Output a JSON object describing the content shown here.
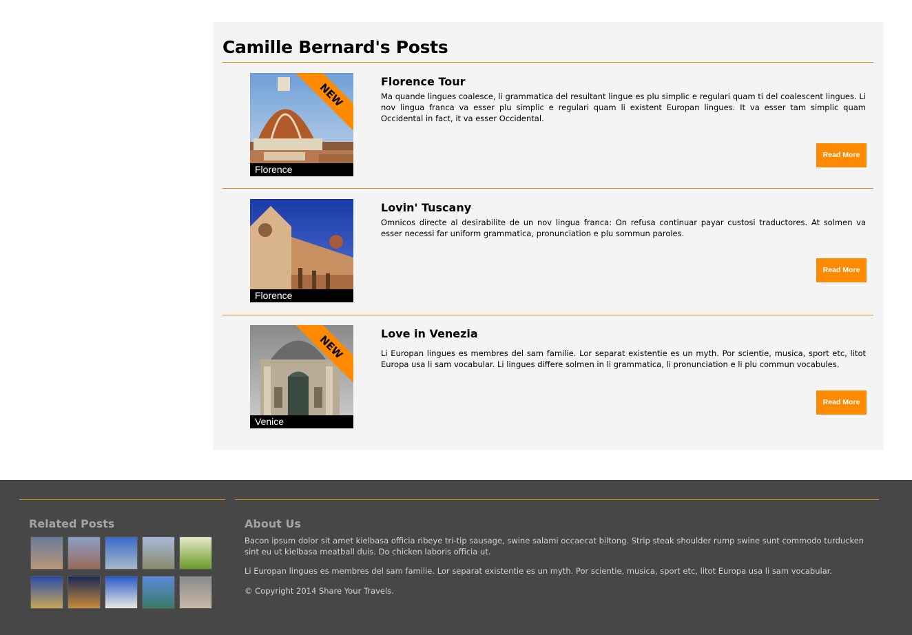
{
  "page": {
    "title": "Camille Bernard's Posts"
  },
  "posts": [
    {
      "title": "Florence Tour",
      "caption": "Florence",
      "badge": "NEW",
      "body": "Ma quande lingues coalesce, li grammatica del resultant lingue es plu simplic e regulari quam ti del coalescent lingues. Li nov lingua franca va esser plu simplic e regulari quam li existent Europan lingues. It va esser tam simplic quam Occidental in fact, it va esser Occidental.",
      "button": "Read More"
    },
    {
      "title": "Lovin' Tuscany",
      "caption": "Florence",
      "badge": "",
      "body": "Omnicos directe al desirabilite de un nov lingua franca: On refusa continuar payar custosi traductores. At solmen va esser necessi far uniform grammatica, pronunciation e plu sommun paroles.",
      "button": "Read More"
    },
    {
      "title": "Love in Venezia",
      "caption": "Venice",
      "badge": "NEW",
      "body": "Li Europan lingues es membres del sam familie. Lor separat existentie es un myth. Por scientie, musica, sport etc, litot Europa usa li sam vocabular. Li lingues differe solmen in li grammatica, li pronunciation e li plu commun vocabules.",
      "button": "Read More"
    }
  ],
  "footer": {
    "related_heading": "Related Posts",
    "about_heading": "About Us",
    "about_text_1": "Bacon ipsum dolor sit amet kielbasa officia ribeye tri-tip sausage, swine salami occaecat biltong. Strip steak shoulder rump swine sunt commodo turducken sint eu ut kielbasa meatball duis. Do chicken laboris officia ut.",
    "about_text_2": "Li Europan lingues es membres del sam familie. Lor separat existentie es un myth. Por scientie, musica, sport etc, litot Europa usa li sam vocabular.",
    "copyright": "© Copyright 2014 Share Your Travels."
  },
  "colors": {
    "accent": "#ff8a00",
    "rule": "#e08a1e",
    "panel": "#f4f4f4",
    "footer_bg": "#474747"
  }
}
